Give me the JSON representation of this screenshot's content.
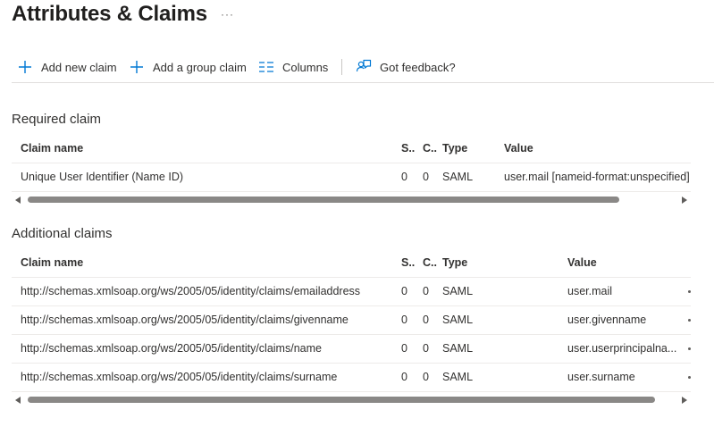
{
  "page": {
    "title": "Attributes & Claims",
    "more_label": "···"
  },
  "toolbar": {
    "add_claim": {
      "label": "Add new claim",
      "icon": "plus-icon"
    },
    "add_group_claim": {
      "label": "Add a group claim",
      "icon": "plus-icon"
    },
    "columns": {
      "label": "Columns",
      "icon": "columns-icon"
    },
    "feedback": {
      "label": "Got feedback?",
      "icon": "feedback-icon"
    }
  },
  "required": {
    "title": "Required claim",
    "headers": {
      "name": "Claim name",
      "s": "S..",
      "c": "C..",
      "type": "Type",
      "value": "Value"
    },
    "rows": [
      {
        "name": "Unique User Identifier (Name ID)",
        "s": "0",
        "c": "0",
        "type": "SAML",
        "value": "user.mail [nameid-format:unspecified]"
      }
    ]
  },
  "additional": {
    "title": "Additional claims",
    "headers": {
      "name": "Claim name",
      "s": "S..",
      "c": "C..",
      "type": "Type",
      "value": "Value"
    },
    "rows": [
      {
        "name": "http://schemas.xmlsoap.org/ws/2005/05/identity/claims/emailaddress",
        "s": "0",
        "c": "0",
        "type": "SAML",
        "value": "user.mail"
      },
      {
        "name": "http://schemas.xmlsoap.org/ws/2005/05/identity/claims/givenname",
        "s": "0",
        "c": "0",
        "type": "SAML",
        "value": "user.givenname"
      },
      {
        "name": "http://schemas.xmlsoap.org/ws/2005/05/identity/claims/name",
        "s": "0",
        "c": "0",
        "type": "SAML",
        "value": "user.userprincipalna..."
      },
      {
        "name": "http://schemas.xmlsoap.org/ws/2005/05/identity/claims/surname",
        "s": "0",
        "c": "0",
        "type": "SAML",
        "value": "user.surname"
      }
    ]
  },
  "colors": {
    "accent": "#0078d4",
    "border": "#edebe9",
    "text": "#323130",
    "scroll_thumb": "#8a8886"
  }
}
